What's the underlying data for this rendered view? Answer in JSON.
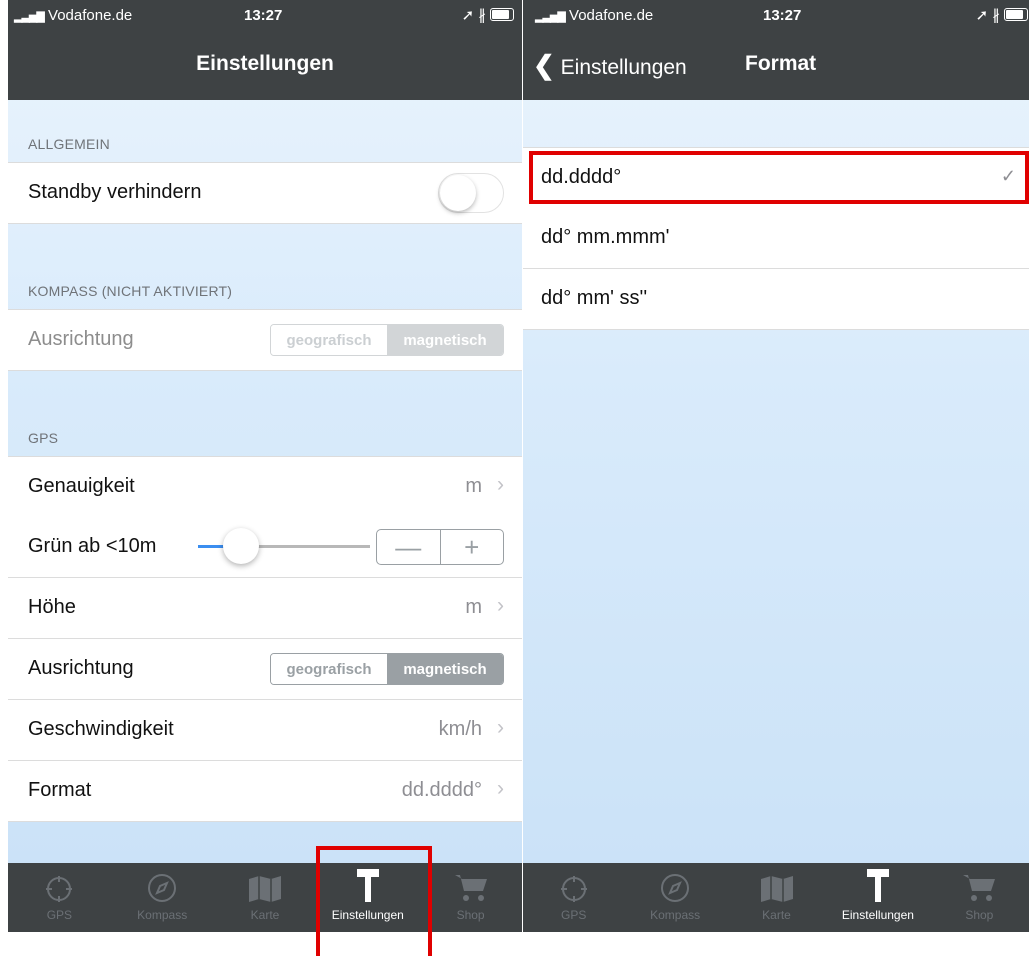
{
  "status": {
    "carrier": "Vodafone.de",
    "time": "13:27"
  },
  "left": {
    "nav_title": "Einstellungen",
    "sections": {
      "allgemein": "ALLGEMEIN",
      "kompass": "KOMPASS (NICHT AKTIVIERT)",
      "gps": "GPS"
    },
    "standby": {
      "label": "Standby verhindern",
      "on": false
    },
    "kompass_ausrichtung": {
      "label": "Ausrichtung",
      "options": [
        "geografisch",
        "magnetisch"
      ],
      "selected": "magnetisch"
    },
    "genauigkeit": {
      "label": "Genauigkeit",
      "value": "m"
    },
    "gruen": {
      "label": "Grün ab <10m",
      "slider_fraction": 0.25,
      "minus": "—",
      "plus": "+"
    },
    "hoehe": {
      "label": "Höhe",
      "value": "m"
    },
    "gps_ausrichtung": {
      "label": "Ausrichtung",
      "options": [
        "geografisch",
        "magnetisch"
      ],
      "selected": "magnetisch"
    },
    "geschwindigkeit": {
      "label": "Geschwindigkeit",
      "value": "km/h"
    },
    "format": {
      "label": "Format",
      "value": "dd.dddd°"
    }
  },
  "right": {
    "back_label": "Einstellungen",
    "nav_title": "Format",
    "options": [
      "dd.dddd°",
      "dd° mm.mmm'",
      "dd° mm' ss''"
    ],
    "selected": "dd.dddd°"
  },
  "tabs": [
    {
      "label": "GPS",
      "icon": "crosshair-icon"
    },
    {
      "label": "Kompass",
      "icon": "compass-icon"
    },
    {
      "label": "Karte",
      "icon": "map-icon"
    },
    {
      "label": "Einstellungen",
      "icon": "hammer-icon",
      "active": true
    },
    {
      "label": "Shop",
      "icon": "cart-icon"
    }
  ],
  "colors": {
    "bar": "#3e4244",
    "highlight": "#e00000",
    "accent": "#3b8ef0"
  }
}
